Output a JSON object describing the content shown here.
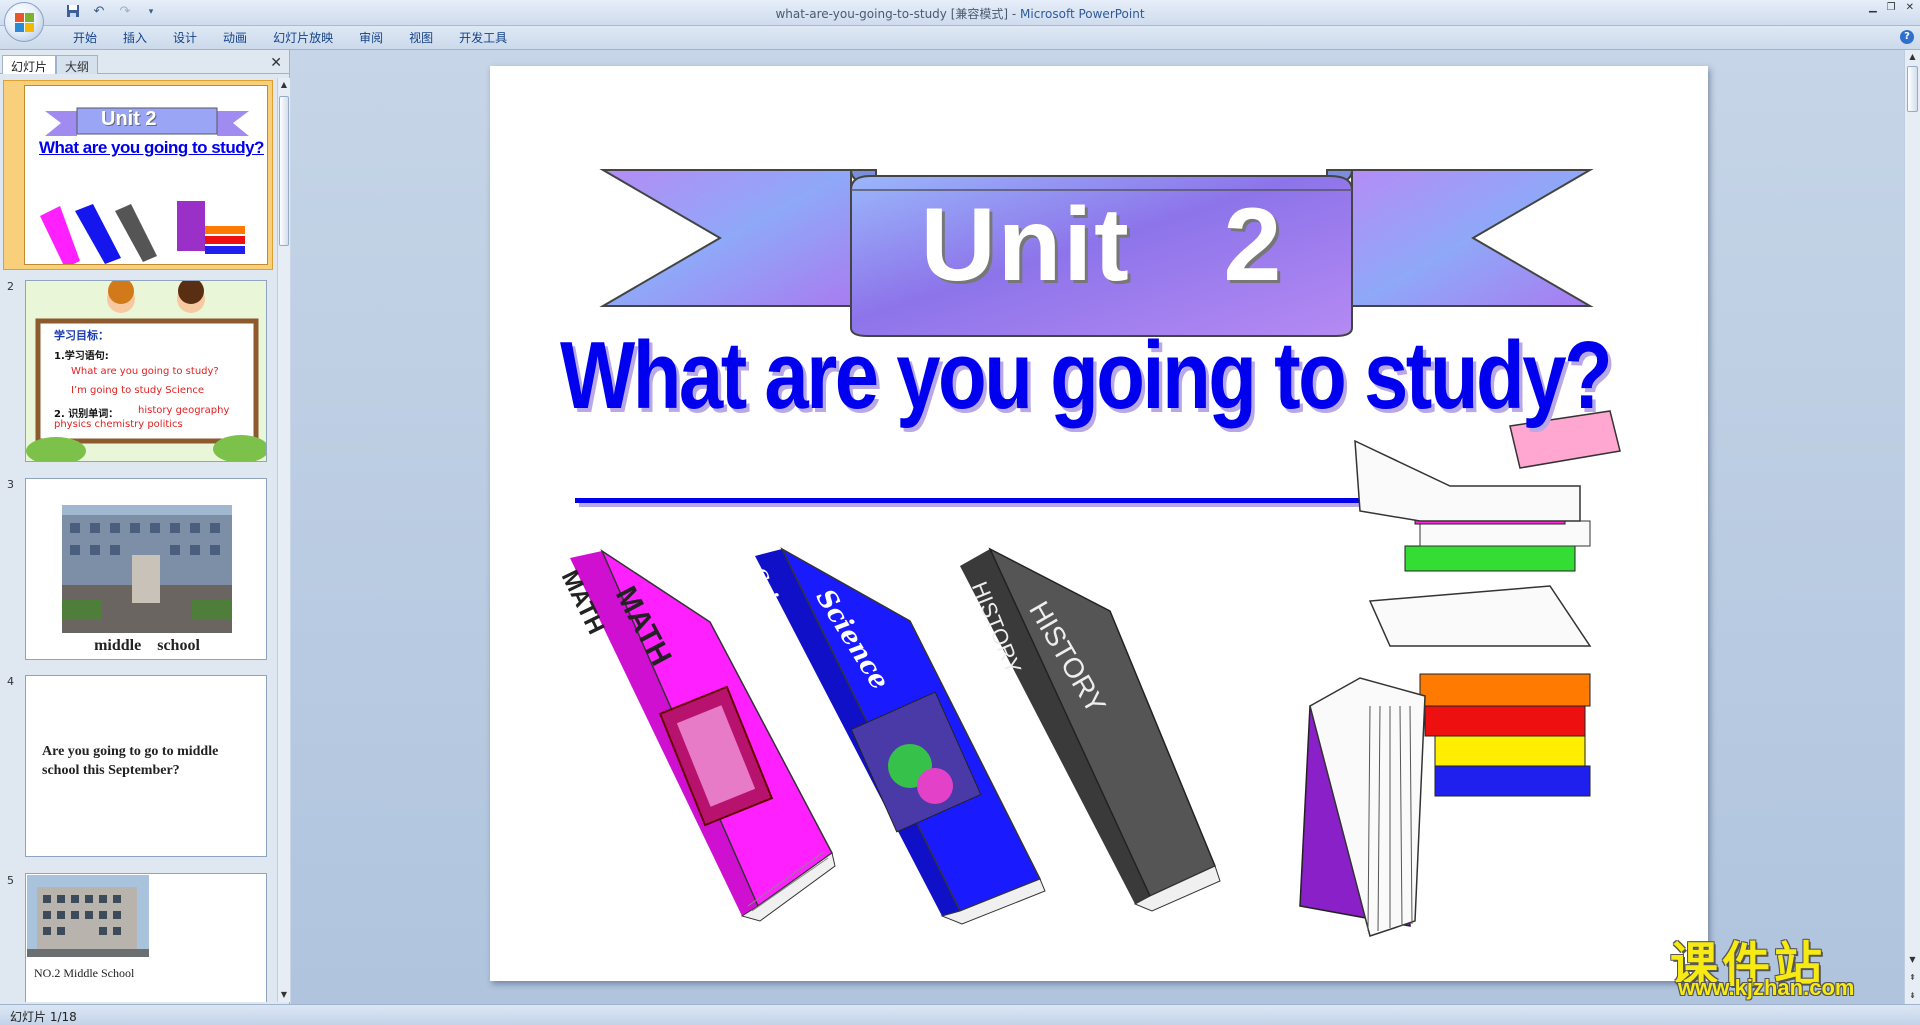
{
  "window": {
    "title_file": "what-are-you-going-to-study [兼容模式]",
    "title_sep": " - ",
    "title_app": "Microsoft PowerPoint"
  },
  "quick_access": [
    "save-icon",
    "undo-icon",
    "redo-icon",
    "customize-icon"
  ],
  "ribbon": {
    "tabs": [
      "开始",
      "插入",
      "设计",
      "动画",
      "幻灯片放映",
      "审阅",
      "视图",
      "开发工具"
    ]
  },
  "left_pane": {
    "tabs": [
      "幻灯片",
      "大纲"
    ],
    "slides": [
      {
        "num": "1",
        "unit": "Unit  2",
        "title": "What are you going to study?"
      },
      {
        "num": "2",
        "heading": "学习目标：",
        "line1": "1.学习语句:",
        "line2": "What are you going to study?",
        "line3": "I’m going to study Science",
        "line4": "2. 识别单词：",
        "words1": "history   geography",
        "words2": "physics    chemistry    politics"
      },
      {
        "num": "3",
        "caption": "middle    school"
      },
      {
        "num": "4",
        "text": "Are you going to go to middle school this September?"
      },
      {
        "num": "5",
        "caption": "NO.2 Middle School"
      }
    ]
  },
  "slide": {
    "unit_label": "Unit   2",
    "title": "What are you going to study?",
    "books": [
      "MATH",
      "MATH",
      "Science",
      "Science",
      "HISTORY",
      "HISTORY"
    ]
  },
  "status": {
    "slide_count": "幻灯片 1/18"
  },
  "watermark": {
    "cn": "课件站",
    "url": "www.kjzhan.com"
  },
  "colors": {
    "accent": "#15428b",
    "title_blue": "#0000ee",
    "banner": "#8f7ee8",
    "selection": "#f8cf7b"
  }
}
